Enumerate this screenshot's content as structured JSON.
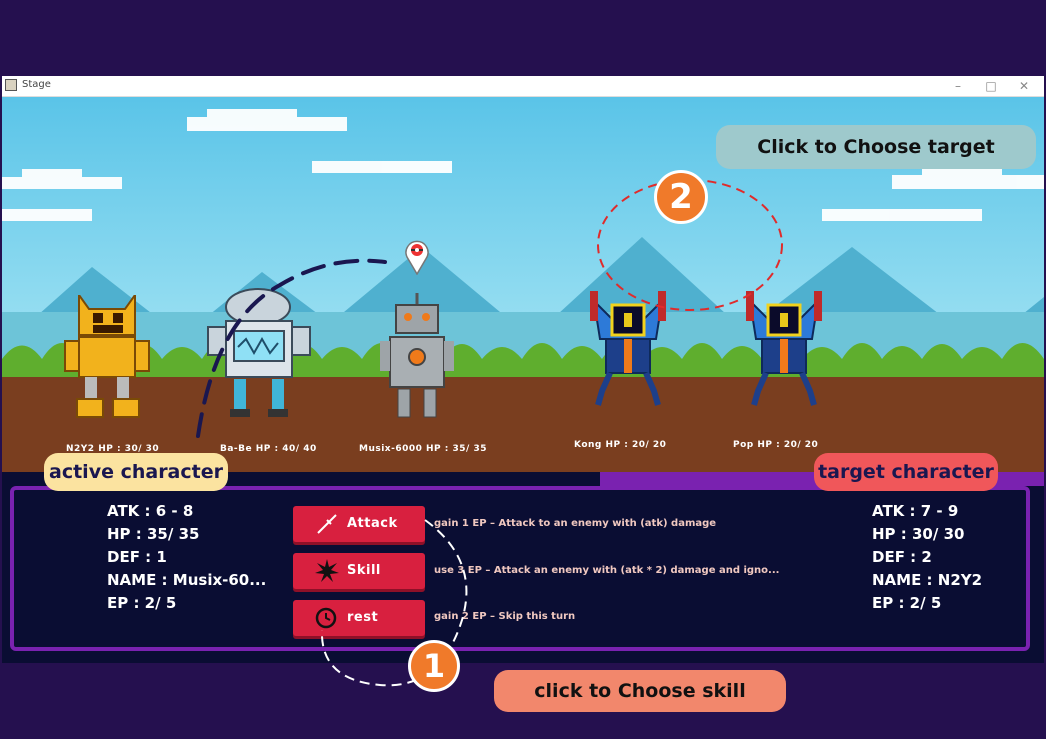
{
  "window": {
    "title": "Stage",
    "minimize": "–",
    "maximize": "□",
    "close": "✕"
  },
  "characters": [
    {
      "name": "N2Y2 HP : 30/ 30"
    },
    {
      "name": "Ba-Be HP : 40/ 40"
    },
    {
      "name": "Musix-6000 HP : 35/ 35"
    },
    {
      "name": "Kong HP : 20/ 20"
    },
    {
      "name": "Pop HP : 20/ 20"
    }
  ],
  "active_stats": {
    "atk": "ATK : 6 - 8",
    "hp": "HP : 35/ 35",
    "def": "DEF : 1",
    "name": "NAME : Musix-60...",
    "ep": "EP : 2/ 5"
  },
  "target_stats": {
    "atk": "ATK : 7 - 9",
    "hp": "HP : 30/ 30",
    "def": "DEF : 2",
    "name": "NAME : N2Y2",
    "ep": "EP : 2/ 5"
  },
  "skills": [
    {
      "label": "Attack",
      "icon": "sword-icon",
      "desc": "gain 1 EP – Attack to an enemy with (atk) damage"
    },
    {
      "label": "Skill",
      "icon": "burst-icon",
      "desc": "use 3 EP – Attack an enemy with (atk * 2) damage and igno..."
    },
    {
      "label": "rest",
      "icon": "rest-clock-icon",
      "desc": "gain 2 EP – Skip this turn"
    }
  ],
  "annotations": {
    "active_character": "active character",
    "target_character": "target character",
    "choose_target": "Click to Choose target",
    "choose_skill": "click to Choose skill",
    "step1": "1",
    "step2": "2"
  },
  "colors": {
    "panel": "#0a0d33",
    "frame": "#7a22b0",
    "button": "#d8203f",
    "step_badge": "#f07a2a"
  }
}
